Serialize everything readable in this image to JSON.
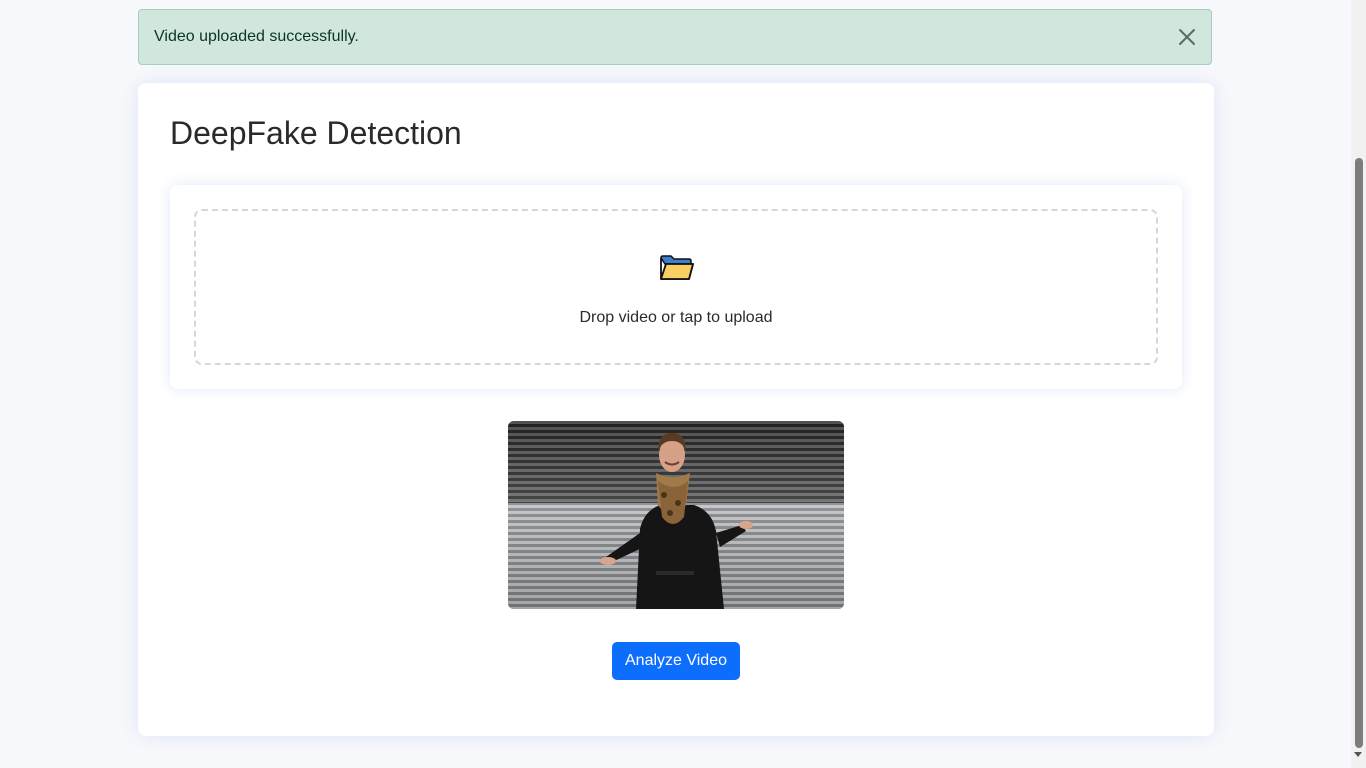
{
  "alert": {
    "message": "Video uploaded successfully.",
    "close_icon": "close-icon",
    "color": "#d1e7dd",
    "text_color": "#0a3622"
  },
  "main": {
    "title": "DeepFake Detection",
    "upload": {
      "icon": "folder-icon",
      "prompt": "Drop video or tap to upload"
    },
    "video": {
      "subject": "video-preview"
    },
    "analyze_button": {
      "label": "Analyze Video",
      "color": "#0d6efd"
    }
  }
}
